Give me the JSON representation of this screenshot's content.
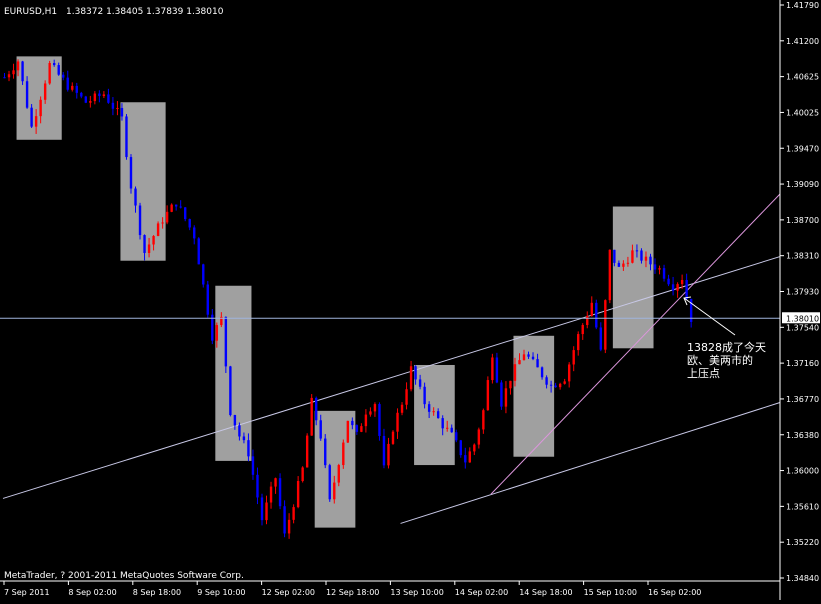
{
  "header": {
    "symbol_timeframe": "EURUSD,H1",
    "ohlc_text": "1.38372 1.38405 1.37839 1.38010"
  },
  "footer": {
    "copyright": "MetaTrader, ? 2001-2011 MetaQuotes Software Corp."
  },
  "annotation": {
    "lines": [
      "13828成了今天",
      "欧、美两市的",
      "上压点"
    ]
  },
  "colors": {
    "background": "#000000",
    "axis": "#ffffff",
    "bull": "#ff0000",
    "bear": "#0000ff",
    "box": "#a0a0a0",
    "trendline": "#c8c8e6",
    "pink_line": "#dc96dc",
    "current_price_line": "#a0b4dc"
  },
  "chart_data": {
    "type": "candlestick",
    "symbol": "EURUSD",
    "timeframe": "H1",
    "ylim": [
      1.3486,
      1.4179
    ],
    "yticks": [
      1.4179,
      1.412,
      1.40625,
      1.40025,
      1.3945,
      1.3886,
      1.3827,
      1.377,
      1.371,
      1.3653,
      1.3595,
      1.3536,
      1.3478
    ],
    "ytick_labels": [
      "1.41790",
      "1.41200",
      "1.40625",
      "1.40025",
      "1.39470",
      "1.39090",
      "1.38700",
      "1.38310",
      "1.37930",
      "1.37540",
      "1.37160",
      "1.36770",
      "1.36380",
      "1.36000",
      "1.35610",
      "1.35220",
      "1.34840"
    ],
    "xtick_labels": [
      "7 Sep 2011",
      "8 Sep 02:00",
      "8 Sep 18:00",
      "9 Sep 10:00",
      "12 Sep 02:00",
      "12 Sep 18:00",
      "13 Sep 10:00",
      "14 Sep 02:00",
      "14 Sep 18:00",
      "15 Sep 10:00",
      "16 Sep 02:00"
    ],
    "xlim_bars": [
      0,
      172
    ],
    "current_price": 1.3801,
    "current_price_label": "1.38010",
    "anchors": [
      [
        0,
        1.409
      ],
      [
        3,
        1.411
      ],
      [
        6,
        1.403
      ],
      [
        10,
        1.4105
      ],
      [
        14,
        1.408
      ],
      [
        18,
        1.406
      ],
      [
        22,
        1.407
      ],
      [
        26,
        1.404
      ],
      [
        28,
        1.396
      ],
      [
        31,
        1.388
      ],
      [
        35,
        1.392
      ],
      [
        38,
        1.394
      ],
      [
        42,
        1.39
      ],
      [
        46,
        1.378
      ],
      [
        48,
        1.38
      ],
      [
        50,
        1.369
      ],
      [
        52,
        1.366
      ],
      [
        54,
        1.364
      ],
      [
        57,
        1.356
      ],
      [
        60,
        1.361
      ],
      [
        62,
        1.354
      ],
      [
        64,
        1.358
      ],
      [
        66,
        1.362
      ],
      [
        68,
        1.37
      ],
      [
        70,
        1.366
      ],
      [
        72,
        1.358
      ],
      [
        74,
        1.363
      ],
      [
        76,
        1.368
      ],
      [
        78,
        1.366
      ],
      [
        80,
        1.369
      ],
      [
        82,
        1.37
      ],
      [
        84,
        1.362
      ],
      [
        86,
        1.367
      ],
      [
        88,
        1.37
      ],
      [
        90,
        1.374
      ],
      [
        93,
        1.37
      ],
      [
        96,
        1.368
      ],
      [
        99,
        1.366
      ],
      [
        102,
        1.363
      ],
      [
        104,
        1.365
      ],
      [
        106,
        1.369
      ],
      [
        108,
        1.376
      ],
      [
        110,
        1.37
      ],
      [
        112,
        1.373
      ],
      [
        115,
        1.376
      ],
      [
        118,
        1.374
      ],
      [
        121,
        1.372
      ],
      [
        124,
        1.373
      ],
      [
        127,
        1.378
      ],
      [
        130,
        1.382
      ],
      [
        132,
        1.376
      ],
      [
        134,
        1.388
      ],
      [
        136,
        1.386
      ],
      [
        139,
        1.388
      ],
      [
        142,
        1.387
      ],
      [
        145,
        1.386
      ],
      [
        148,
        1.384
      ],
      [
        150,
        1.385
      ],
      [
        152,
        1.3801
      ]
    ],
    "boxes": [
      {
        "x0": 3,
        "x1": 13,
        "y0": 1.4015,
        "y1": 1.4115
      },
      {
        "x0": 26,
        "x1": 36,
        "y0": 1.387,
        "y1": 1.406
      },
      {
        "x0": 47,
        "x1": 55,
        "y0": 1.363,
        "y1": 1.384
      },
      {
        "x0": 69,
        "x1": 78,
        "y0": 1.355,
        "y1": 1.369
      },
      {
        "x0": 91,
        "x1": 100,
        "y0": 1.3625,
        "y1": 1.3745
      },
      {
        "x0": 113,
        "x1": 122,
        "y0": 1.3635,
        "y1": 1.378
      },
      {
        "x0": 135,
        "x1": 144,
        "y0": 1.3765,
        "y1": 1.3935
      }
    ],
    "trendlines": [
      {
        "name": "",
        "x0": 0,
        "y0": 1.3585,
        "x1": 172,
        "y1": 1.3875,
        "style": "trendline"
      },
      {
        "name": "",
        "x0": 88,
        "y0": 1.3555,
        "x1": 172,
        "y1": 1.37,
        "style": "trendline"
      },
      {
        "name": "",
        "x0": 108,
        "y0": 1.359,
        "x1": 172,
        "y1": 1.395,
        "style": "pink_line"
      }
    ]
  }
}
